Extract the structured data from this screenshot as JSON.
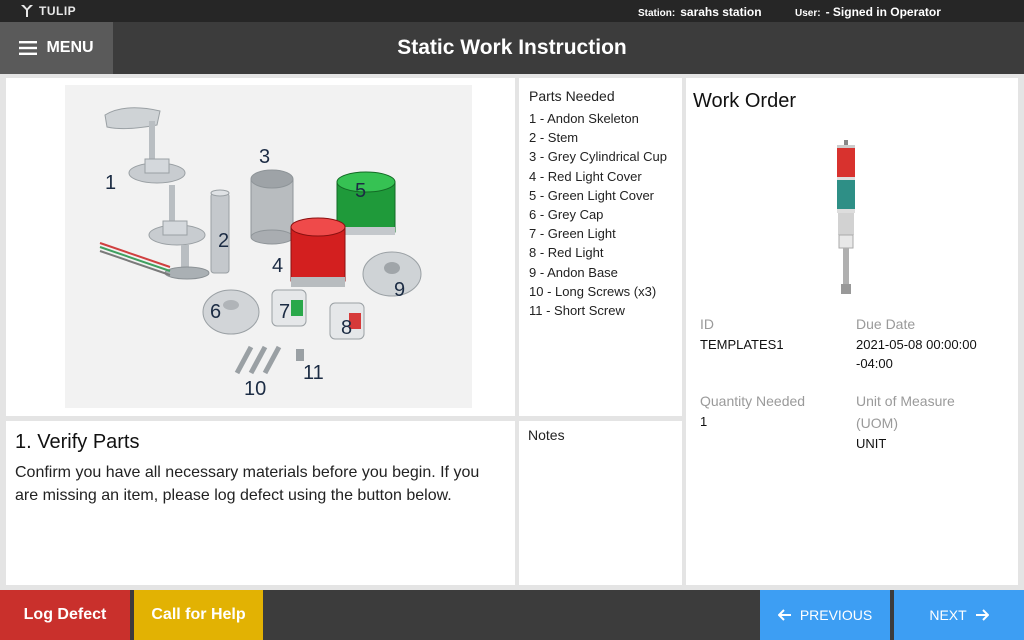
{
  "topbar": {
    "logo_text": "TULIP",
    "station_label": "Station:",
    "station_value": "sarahs station",
    "user_label": "User:",
    "user_value": "- Signed in Operator"
  },
  "header": {
    "menu_label": "MENU",
    "title": "Static Work Instruction"
  },
  "image_panel": {
    "callouts": [
      "1",
      "2",
      "3",
      "4",
      "5",
      "6",
      "7",
      "8",
      "9",
      "10",
      "11"
    ]
  },
  "parts": {
    "title": "Parts Needed",
    "items": [
      "1 - Andon Skeleton",
      "2 - Stem",
      "3 - Grey Cylindrical Cup",
      "4 - Red Light Cover",
      "5 - Green Light Cover",
      "6 - Grey Cap",
      "7 - Green Light",
      "8 - Red Light",
      "9 - Andon Base",
      "10 - Long Screws (x3)",
      "11 - Short Screw"
    ]
  },
  "work_order": {
    "title": "Work Order",
    "id_label": "ID",
    "id_value": "TEMPLATES1",
    "due_label": "Due Date",
    "due_value_line1": "2021-05-08 00:00:00",
    "due_value_line2": "-04:00",
    "qty_label": "Quantity Needed",
    "qty_value": "1",
    "uom_label_line1": "Unit of Measure",
    "uom_label_line2": "(UOM)",
    "uom_value": "UNIT"
  },
  "instruction": {
    "title": "1. Verify Parts",
    "body": "Confirm you have all necessary materials before you begin. If you are missing an item, please log defect using the button below."
  },
  "notes": {
    "title": "Notes"
  },
  "footer": {
    "log_defect": "Log Defect",
    "call_help": "Call for Help",
    "previous": "PREVIOUS",
    "next": "NEXT"
  },
  "colors": {
    "topbar": "#262626",
    "header": "#3c3c3c",
    "menu": "#5a5a5a",
    "defect": "#c9302c",
    "help": "#e2b203",
    "nav": "#3d9ef3"
  }
}
